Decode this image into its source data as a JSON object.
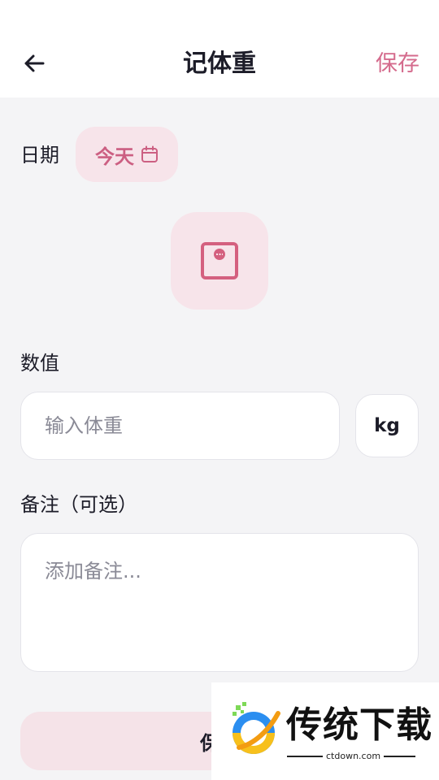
{
  "header": {
    "title": "记体重",
    "save_label": "保存",
    "back_icon": "arrow-left-icon"
  },
  "date": {
    "label": "日期",
    "value": "今天",
    "icon": "calendar-icon"
  },
  "scale": {
    "icon": "scale-icon"
  },
  "value": {
    "label": "数值",
    "placeholder": "输入体重",
    "unit": "kg"
  },
  "note": {
    "label": "备注（可选）",
    "placeholder": "添加备注..."
  },
  "footer": {
    "save_label": "保存"
  },
  "watermark": {
    "title": "传统下载",
    "site": "ctdown.com"
  },
  "colors": {
    "accent": "#d46a8c",
    "accent_light": "#f7e4ea",
    "background": "#f4f4f6",
    "text": "#1c1c28",
    "placeholder": "#8a8a96"
  }
}
